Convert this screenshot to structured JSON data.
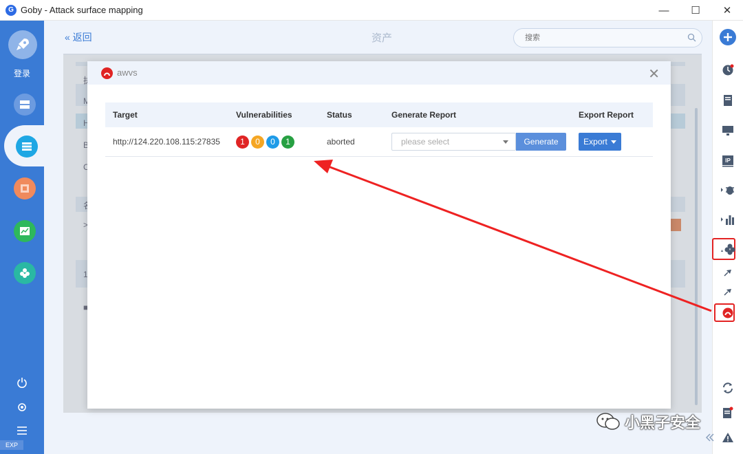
{
  "window": {
    "title": "Goby - Attack surface mapping",
    "minimize": "—",
    "maximize": "☐",
    "close": "✕"
  },
  "left_sidebar": {
    "login_label": "登录",
    "exp_badge": "EXP"
  },
  "header": {
    "back_label": "« 返回",
    "page_title": "资产",
    "search_placeholder": "搜索"
  },
  "background_rows": [
    "执",
    "M",
    "H",
    "B",
    "C",
    "名",
    ">",
    "1",
    "■"
  ],
  "modal": {
    "title": "awvs",
    "close": "✕",
    "columns": [
      "Target",
      "Vulnerabilities",
      "Status",
      "Generate Report",
      "Export Report"
    ],
    "rows": [
      {
        "target": "http://124.220.108.115:27835",
        "vulnerabilities": [
          {
            "count": "1",
            "color": "#e02424"
          },
          {
            "count": "0",
            "color": "#f5a623"
          },
          {
            "count": "0",
            "color": "#1e9be8"
          },
          {
            "count": "1",
            "color": "#27a042"
          }
        ],
        "status": "aborted",
        "select_placeholder": "please select",
        "generate_label": "Generate",
        "export_label": "Export"
      }
    ]
  },
  "watermark": {
    "text": "小黑子安全"
  },
  "colors": {
    "accent": "#3a7bd5",
    "highlight": "#e32222"
  }
}
